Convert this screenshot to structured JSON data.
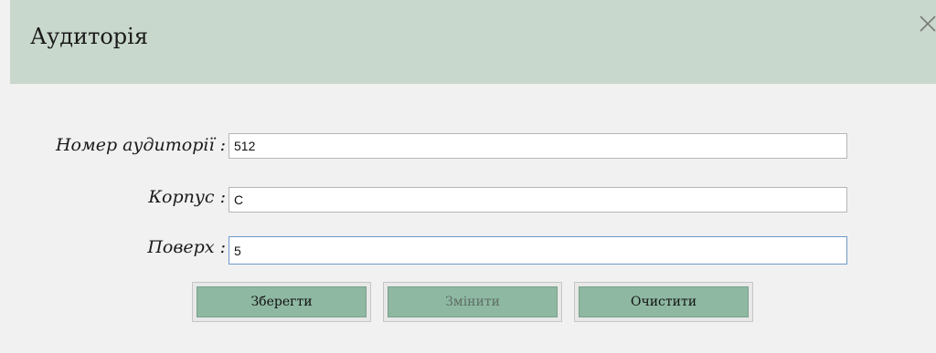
{
  "window": {
    "title": "Аудиторія",
    "close_icon": "close-icon"
  },
  "form": {
    "room_number": {
      "label": "Номер аудиторії :",
      "value": "512"
    },
    "building": {
      "label": "Корпус :",
      "value": "C"
    },
    "floor": {
      "label": "Поверх :",
      "value": "5"
    }
  },
  "buttons": {
    "save": "Зберегти",
    "edit": "Змінити",
    "clear": "Очистити"
  },
  "colors": {
    "header_bg": "#c9d8cc",
    "button_bg": "#8eb8a2",
    "focus_border": "#6f99c8"
  }
}
